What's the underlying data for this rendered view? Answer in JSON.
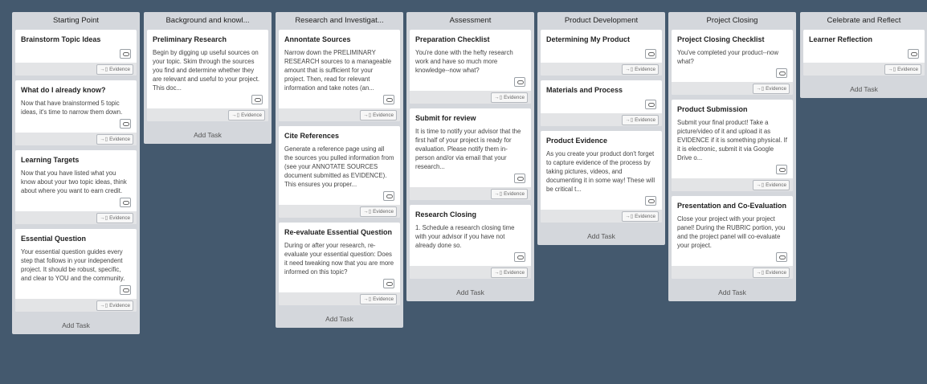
{
  "ui": {
    "add_task_label": "Add Task",
    "evidence_label": "Evidence",
    "evidence_icon": "→⃞",
    "comment_icon": "comment-icon",
    "colors": {
      "background": "#44596e",
      "column": "#d4d7dc",
      "card": "#ffffff",
      "card_footer": "#e3e4e6"
    }
  },
  "columns": [
    {
      "title": "Starting Point",
      "cards": [
        {
          "title": "Brainstorm Topic Ideas",
          "desc": ""
        },
        {
          "title": "What do I already know?",
          "desc": "Now that have brainstormed 5 topic ideas, it's time to narrow them down."
        },
        {
          "title": "Learning Targets",
          "desc": "Now that you have listed what you know about your two topic ideas, think about where you want to earn credit."
        },
        {
          "title": "Essential Question",
          "desc": "Your essential question guides every step that follows in your independent project. It should be robust, specific, and clear to YOU and the community."
        }
      ]
    },
    {
      "title": "Background and knowl...",
      "cards": [
        {
          "title": "Preliminary Research",
          "desc": "Begin by digging up useful sources on your topic. Skim through the sources you find and determine whether they are relevant and useful to your project. This doc..."
        }
      ]
    },
    {
      "title": "Research and Investigat...",
      "cards": [
        {
          "title": "Annontate Sources",
          "desc": "Narrow down the PRELIMINARY RESEARCH sources to a manageable amount that is sufficient for your project. Then, read for relevant information and take notes (an..."
        },
        {
          "title": "Cite References",
          "desc": "Generate a reference page using all the sources you pulled information from (see your ANNOTATE SOURCES document submitted as EVIDENCE). This ensures you proper..."
        },
        {
          "title": "Re-evaluate Essential Question",
          "desc": "During or after your research, re-evaluate your essential question: Does it need tweaking now that you are more informed on this topic?"
        }
      ]
    },
    {
      "title": "Assessment",
      "cards": [
        {
          "title": "Preparation Checklist",
          "desc": "You're done with the hefty research work and have so much more knowledge--now what?"
        },
        {
          "title": "Submit for review",
          "desc": "It is time to notify your advisor that the first half of your project is ready for evaluation. Please notify them in-person and/or via email that your research..."
        },
        {
          "title": "Research Closing",
          "desc": "1. Schedule a research closing time with your advisor if you have not already done so."
        }
      ]
    },
    {
      "title": "Product Development",
      "cards": [
        {
          "title": "Determining My Product",
          "desc": ""
        },
        {
          "title": "Materials and Process",
          "desc": ""
        },
        {
          "title": "Product Evidence",
          "desc": "As you create your product don't forget to capture evidence of the process by taking pictures, videos, and documenting it in some way! These will be critical t..."
        }
      ]
    },
    {
      "title": "Project Closing",
      "cards": [
        {
          "title": "Project Closing Checklist",
          "desc": "You've completed your product--now what?"
        },
        {
          "title": "Product Submission",
          "desc": "Submit your final product! Take a picture/video of it and upload it as EVIDENCE if it is something physical. If it is electronic, submit it via Google Drive o..."
        },
        {
          "title": "Presentation and Co-Evaluation",
          "desc": "Close your project with your project panel! During the RUBRIC portion, you and the project panel will co-evaluate your project."
        }
      ]
    },
    {
      "title": "Celebrate and Reflect",
      "cards": [
        {
          "title": "Learner Reflection",
          "desc": ""
        }
      ]
    }
  ]
}
